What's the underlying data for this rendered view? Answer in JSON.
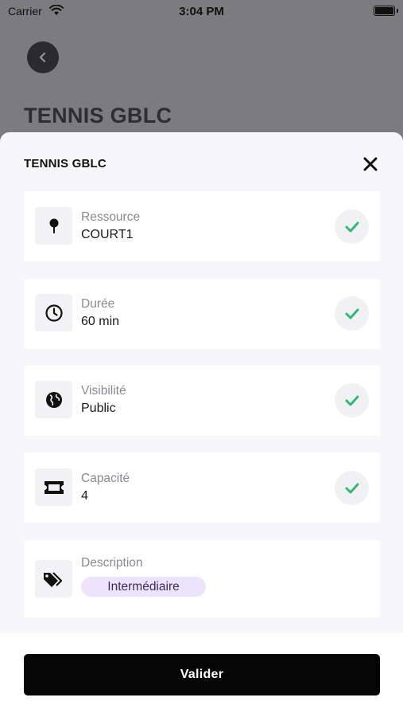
{
  "status_bar": {
    "carrier": "Carrier",
    "time": "3:04 PM"
  },
  "background_page": {
    "title": "TENNIS GBLC"
  },
  "sheet": {
    "title": "TENNIS GBLC",
    "rows": [
      {
        "label": "Ressource",
        "value": "COURT1",
        "icon": "tennis-racket-icon"
      },
      {
        "label": "Durée",
        "value": "60 min",
        "icon": "clock-icon"
      },
      {
        "label": "Visibilité",
        "value": "Public",
        "icon": "globe-icon"
      },
      {
        "label": "Capacité",
        "value": "4",
        "icon": "ticket-icon"
      }
    ],
    "description": {
      "label": "Description",
      "tag": "Intermédiaire",
      "icon": "tags-icon"
    }
  },
  "footer": {
    "validate_label": "Valider"
  },
  "colors": {
    "check_green": "#2fb87a",
    "tag_bg": "#ece4fc",
    "button_bg": "#050505"
  }
}
